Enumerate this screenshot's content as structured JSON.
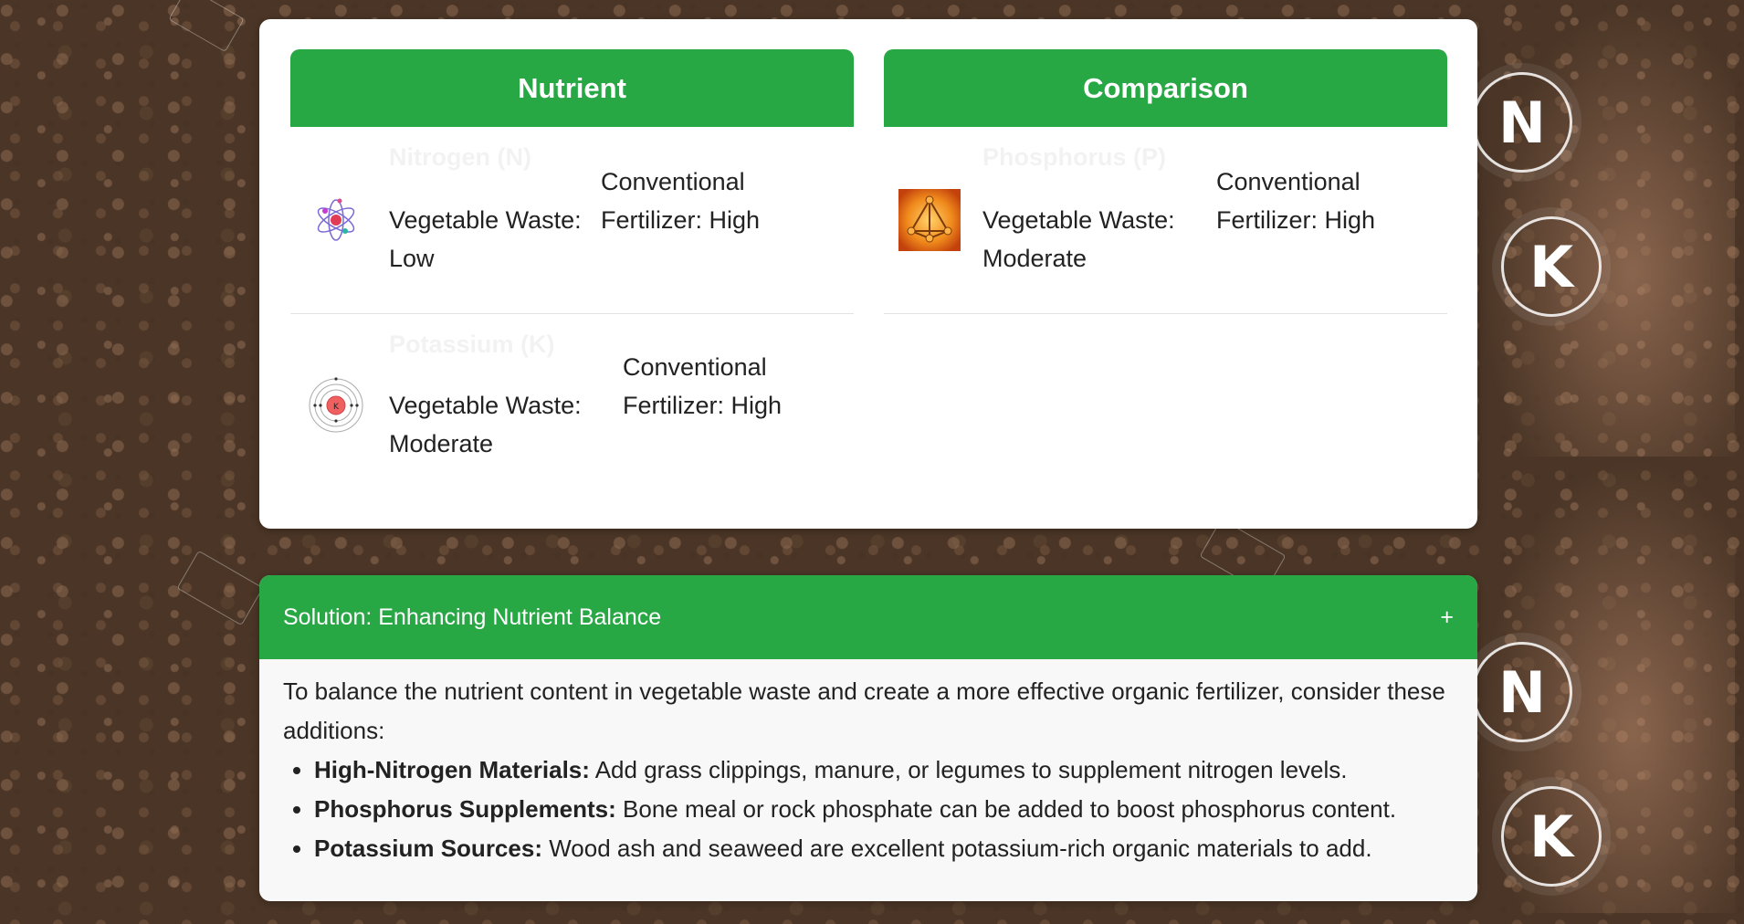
{
  "table": {
    "headers": {
      "nutrient": "Nutrient",
      "comparison": "Comparison"
    },
    "left_rows": [
      {
        "ghost_label": "Nitrogen (N)",
        "vegetable_waste": "Vegetable Waste: Low",
        "conventional": "Conventional Fertilizer: High",
        "icon": "atom-icon"
      },
      {
        "ghost_label": "Potassium (K)",
        "vegetable_waste": "Vegetable Waste: Moderate",
        "conventional": "Conventional Fertilizer: High",
        "icon": "potassium-atom-icon"
      }
    ],
    "right_rows": [
      {
        "ghost_label": "Phosphorus (P)",
        "vegetable_waste": "Vegetable Waste: Moderate",
        "conventional": "Conventional Fertilizer: High",
        "icon": "phosphorus-molecule-icon"
      }
    ]
  },
  "solution": {
    "title": "Solution: Enhancing Nutrient Balance",
    "toggle": "+",
    "intro": "To balance the nutrient content in vegetable waste and create a more effective organic fertilizer, consider these additions:",
    "items": [
      {
        "label": "High-Nitrogen Materials:",
        "text": " Add grass clippings, manure, or legumes to supplement nitrogen levels."
      },
      {
        "label": "Phosphorus Supplements:",
        "text": " Bone meal or rock phosphate can be added to boost phosphorus content."
      },
      {
        "label": "Potassium Sources:",
        "text": " Wood ash and seaweed are excellent potassium-rich organic materials to add."
      }
    ]
  },
  "background": {
    "badges": [
      "N",
      "K",
      "N",
      "K"
    ]
  },
  "colors": {
    "accent": "#28a745",
    "card": "#ffffff",
    "panel": "#f8f8f8"
  }
}
